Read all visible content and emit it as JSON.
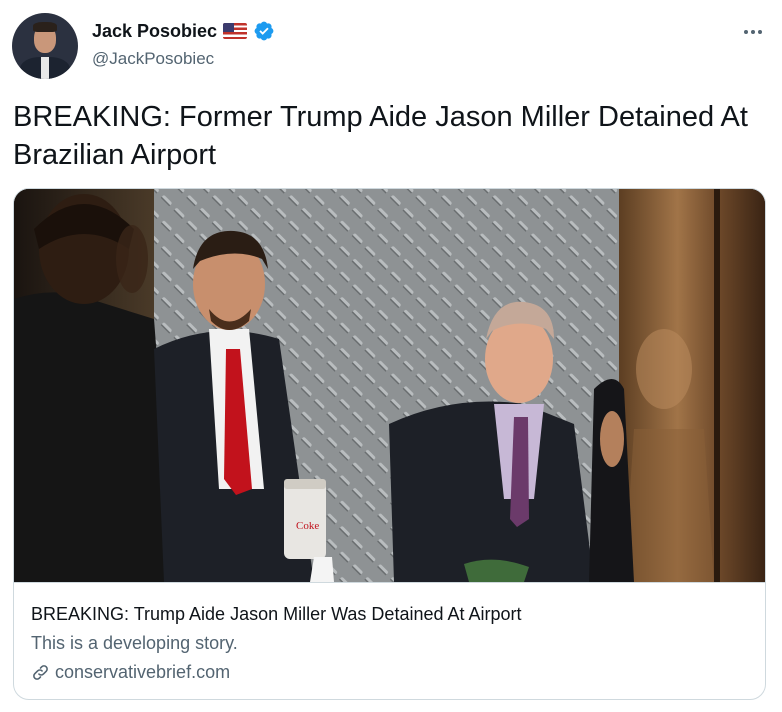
{
  "author": {
    "display_name": "Jack Posobiec",
    "handle": "@JackPosobiec",
    "flag_icon": "us-flag-icon",
    "verified_icon": "verified-badge-icon",
    "verified_color": "#1d9bf0"
  },
  "tweet": {
    "text": "BREAKING: Former Trump Aide Jason Miller Detained At Brazilian Airport"
  },
  "card": {
    "title": "BREAKING: Trump Aide Jason Miller Was Detained At Airport",
    "description": "This is a developing story.",
    "domain": "conservativebrief.com",
    "link_icon": "link-icon"
  },
  "colors": {
    "text_primary": "#0f1419",
    "text_secondary": "#536471",
    "border": "#cfd9de"
  }
}
